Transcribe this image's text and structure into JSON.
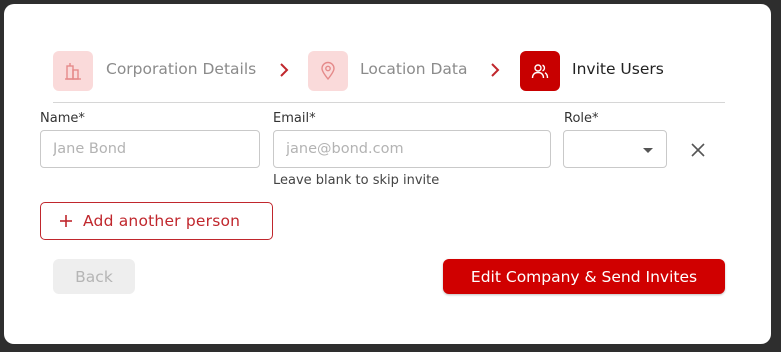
{
  "colors": {
    "accent": "#d00000",
    "accent_light": "#fadada",
    "muted_text": "#8b8b8b"
  },
  "steps": [
    {
      "label": "Corporation Details",
      "icon": "building-icon",
      "state": "done"
    },
    {
      "label": "Location Data",
      "icon": "location-pin-icon",
      "state": "done"
    },
    {
      "label": "Invite Users",
      "icon": "users-icon",
      "state": "active"
    }
  ],
  "form": {
    "name": {
      "label": "Name*",
      "value": "",
      "placeholder": "Jane Bond"
    },
    "email": {
      "label": "Email*",
      "value": "",
      "placeholder": "jane@bond.com",
      "helper": "Leave blank to skip invite"
    },
    "role": {
      "label": "Role*",
      "value": ""
    }
  },
  "buttons": {
    "add_person": "Add another person",
    "back": "Back",
    "submit": "Edit Company & Send Invites"
  }
}
